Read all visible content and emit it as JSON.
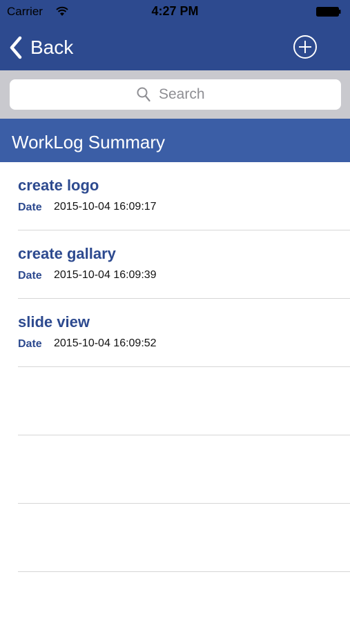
{
  "status_bar": {
    "carrier": "Carrier",
    "time": "4:27 PM",
    "icons": [
      "wifi-icon",
      "battery-icon"
    ]
  },
  "nav": {
    "back_label": "Back",
    "add_icon": "plus-circle-icon",
    "background_color": "#2d4a8f"
  },
  "search": {
    "placeholder": "Search",
    "icon": "search-icon"
  },
  "section": {
    "title": "WorkLog Summary",
    "background_color": "#3b5ea6"
  },
  "worklogs": [
    {
      "title": "create logo",
      "date_label": "Date",
      "date": "2015-10-04 16:09:17"
    },
    {
      "title": "create gallary",
      "date_label": "Date",
      "date": "2015-10-04 16:09:39"
    },
    {
      "title": "slide view",
      "date_label": "Date",
      "date": "2015-10-04 16:09:52"
    },
    {
      "title": "",
      "date_label": "",
      "date": ""
    },
    {
      "title": "",
      "date_label": "",
      "date": ""
    },
    {
      "title": "",
      "date_label": "",
      "date": ""
    }
  ]
}
